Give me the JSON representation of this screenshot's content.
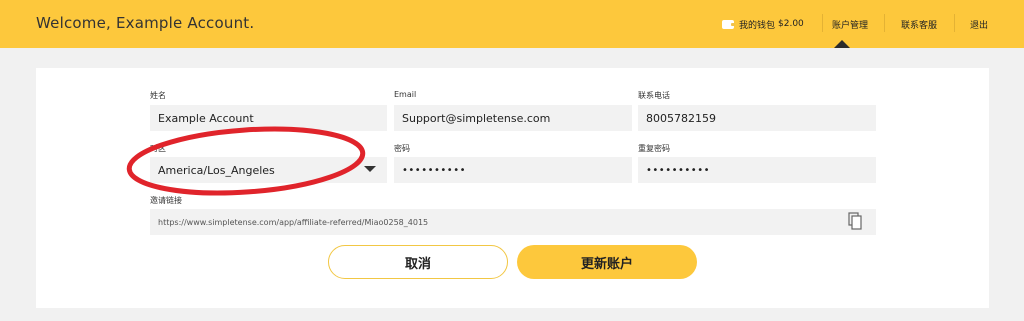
{
  "header": {
    "welcome": "Welcome, Example Account.",
    "wallet_label": "我的钱包",
    "wallet_amount": "$2.00",
    "nav_account": "账户管理",
    "nav_support": "联系客服",
    "nav_logout": "退出"
  },
  "form": {
    "name_label": "姓名",
    "name_value": "Example Account",
    "email_label": "Email",
    "email_value": "Support@simpletense.com",
    "phone_label": "联系电话",
    "phone_value": "8005782159",
    "timezone_label": "时区",
    "timezone_value": "America/Los_Angeles",
    "password_label": "密码",
    "password_value": "••••••••••",
    "confirm_password_label": "重复密码",
    "confirm_password_value": "••••••••••",
    "invite_label": "邀请链接",
    "invite_value": "https://www.simpletense.com/app/affiliate-referred/Miao0258_4015"
  },
  "actions": {
    "cancel_label": "取消",
    "update_label": "更新账户"
  },
  "colors": {
    "accent": "#fdc83c",
    "annotation": "#e0242b"
  },
  "icons": [
    "wallet-icon",
    "chevron-down-icon",
    "copy-icon"
  ]
}
